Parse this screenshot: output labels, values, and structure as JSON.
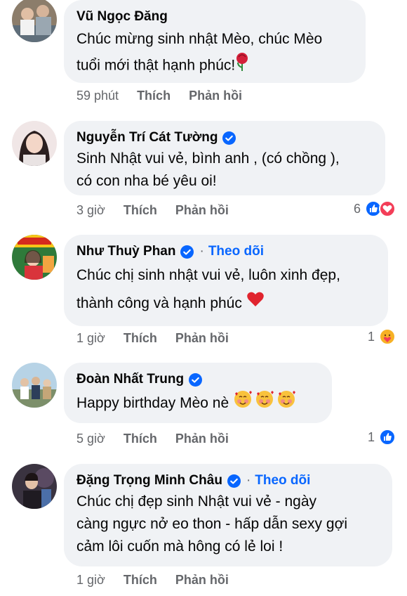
{
  "comments": [
    {
      "author": "Vũ Ngọc Đăng",
      "verified": false,
      "follow": "",
      "lines": [
        "Chúc mừng sinh nhật Mèo, chúc Mèo",
        "tuổi mới thật hạnh phúc!"
      ],
      "time": "59 phút",
      "like": "Thích",
      "reply": "Phản hồi",
      "reaction_count": "",
      "reactions": []
    },
    {
      "author": "Nguyễn Trí Cát Tường",
      "verified": true,
      "follow": "",
      "lines": [
        "Sinh Nhật vui vẻ, bình anh , (có chồng ),",
        "có con nha bé yêu oi!"
      ],
      "time": "3 giờ",
      "like": "Thích",
      "reply": "Phản hồi",
      "reaction_count": "6",
      "reactions": [
        "like-icon",
        "love-icon"
      ]
    },
    {
      "author": "Như Thuỳ Phan",
      "verified": true,
      "follow": "Theo dõi",
      "lines": [
        "Chúc chị sinh nhật vui vẻ, luôn xinh đẹp,",
        "thành công và hạnh phúc"
      ],
      "time": "1 giờ",
      "like": "Thích",
      "reply": "Phản hồi",
      "reaction_count": "1",
      "reactions": [
        "care-icon"
      ]
    },
    {
      "author": "Đoàn Nhất Trung",
      "verified": true,
      "follow": "",
      "lines": [
        "Happy birthday Mèo nè"
      ],
      "time": "5 giờ",
      "like": "Thích",
      "reply": "Phản hồi",
      "reaction_count": "1",
      "reactions": [
        "like-icon"
      ]
    },
    {
      "author": "Đặng Trọng Minh Châu",
      "verified": true,
      "follow": "Theo dõi",
      "lines": [
        "Chúc chị đẹp sinh Nhật vui vẻ - ngày",
        "càng ngực nở eo thon - hấp dẫn sexy gợi",
        "cảm lôi cuốn mà hông có lẻ loi !"
      ],
      "time": "1 giờ",
      "like": "Thích",
      "reply": "Phản hồi",
      "reaction_count": "",
      "reactions": []
    }
  ],
  "separator": "·",
  "colors": {
    "bubble": "#f0f2f5",
    "meta": "#65676b",
    "link": "#0866ff",
    "like": "#0866ff",
    "love": "#f33e58"
  }
}
